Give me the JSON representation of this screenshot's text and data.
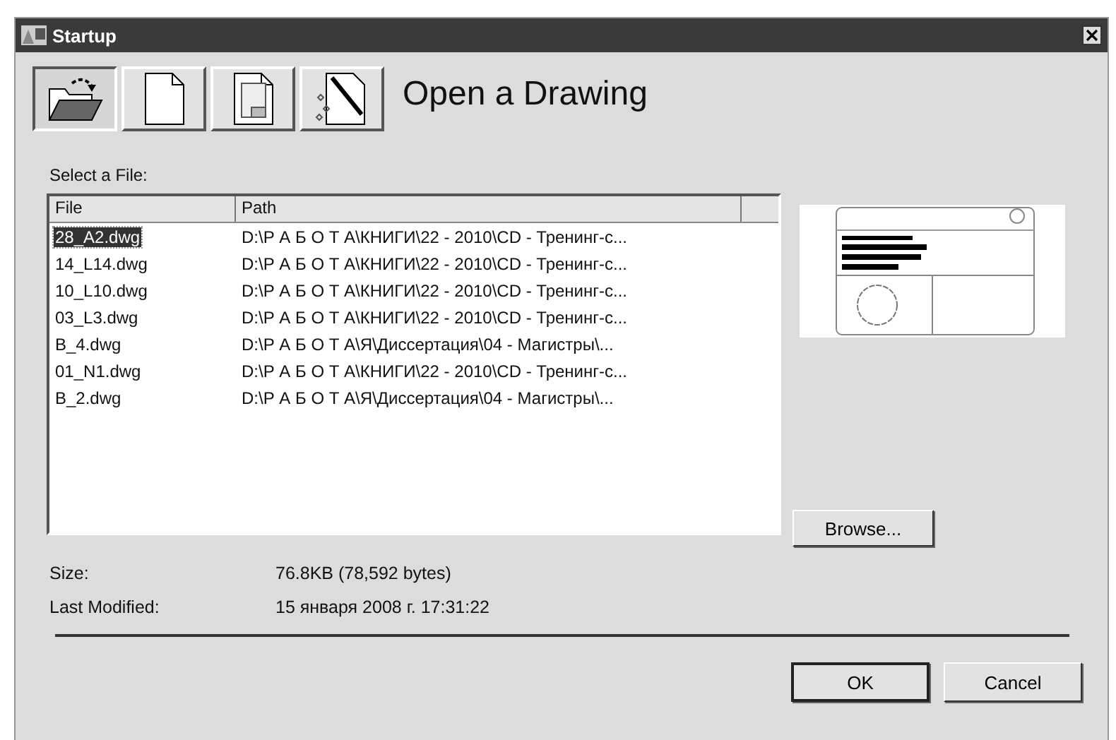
{
  "window": {
    "title": "Startup"
  },
  "modes": [
    {
      "kind": "open",
      "selected": true
    },
    {
      "kind": "blank",
      "selected": false
    },
    {
      "kind": "template",
      "selected": false
    },
    {
      "kind": "wizard",
      "selected": false
    }
  ],
  "heading": "Open a Drawing",
  "file_list": {
    "label": "Select a File:",
    "columns": [
      "File",
      "Path"
    ],
    "rows": [
      {
        "file": "28_A2.dwg",
        "path": "D:\\Р А Б О Т А\\КНИГИ\\22 - 2010\\CD - Тренинг-с...",
        "selected": true
      },
      {
        "file": "14_L14.dwg",
        "path": "D:\\Р А Б О Т А\\КНИГИ\\22 - 2010\\CD - Тренинг-с...",
        "selected": false
      },
      {
        "file": "10_L10.dwg",
        "path": "D:\\Р А Б О Т А\\КНИГИ\\22 - 2010\\CD - Тренинг-с...",
        "selected": false
      },
      {
        "file": "03_L3.dwg",
        "path": "D:\\Р А Б О Т А\\КНИГИ\\22 - 2010\\CD - Тренинг-с...",
        "selected": false
      },
      {
        "file": "B_4.dwg",
        "path": "D:\\Р А Б О Т А\\Я\\Диссертация\\04 - Магистры\\...",
        "selected": false
      },
      {
        "file": "01_N1.dwg",
        "path": "D:\\Р А Б О Т А\\КНИГИ\\22 - 2010\\CD - Тренинг-с...",
        "selected": false
      },
      {
        "file": "B_2.dwg",
        "path": "D:\\Р А Б О Т А\\Я\\Диссертация\\04 - Магистры\\...",
        "selected": false
      }
    ]
  },
  "browse_button": "Browse...",
  "details": [
    {
      "label": "Size:",
      "value": "76.8KB (78,592 bytes)"
    },
    {
      "label": "Last Modified:",
      "value": "15 января 2008 г.  17:31:22"
    }
  ],
  "buttons": [
    "OK",
    "Cancel"
  ]
}
